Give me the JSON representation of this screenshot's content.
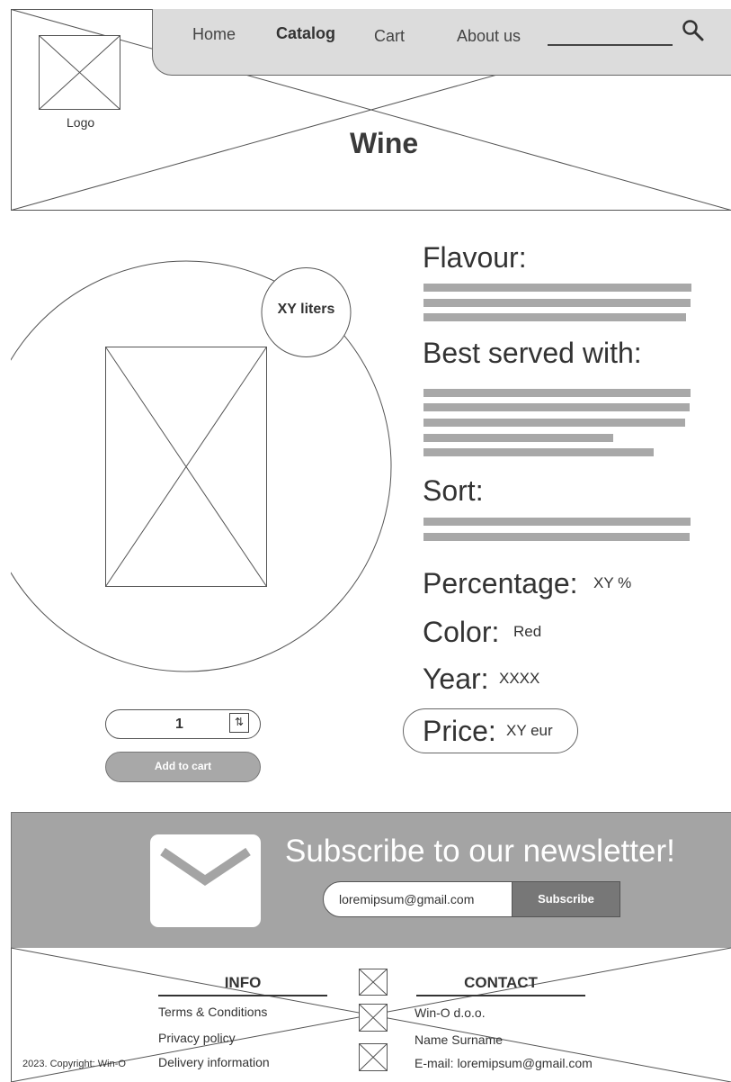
{
  "header": {
    "nav": [
      "Home",
      "Catalog",
      "Cart",
      "About us"
    ],
    "active_nav": "Catalog",
    "logo_label": "Logo",
    "page_title": "Wine",
    "search_icon": "search-icon"
  },
  "product": {
    "volume_badge": "XY liters",
    "flavour_heading": "Flavour:",
    "served_heading": "Best served with:",
    "sort_heading": "Sort:",
    "percentage_label": "Percentage:",
    "percentage_value": "XY %",
    "color_label": "Color:",
    "color_value": "Red",
    "year_label": "Year:",
    "year_value": "XXXX",
    "price_label": "Price:",
    "price_value": "XY eur",
    "quantity": "1",
    "quantity_icon": "swap-vertical-icon",
    "add_to_cart": "Add to cart"
  },
  "newsletter": {
    "title": "Subscribe to our newsletter!",
    "email_value": "loremipsum@gmail.com",
    "subscribe_label": "Subscribe",
    "icon": "envelope-icon"
  },
  "footer": {
    "info_heading": "INFO",
    "info_links": [
      "Terms & Conditions",
      "Privacy policy",
      "Delivery information"
    ],
    "contact_heading": "CONTACT",
    "contact_lines": [
      "Win-O d.o.o.",
      "Name Surname",
      "E-mail: loremipsum@gmail.com"
    ],
    "copyright": "2023. Copyright: Win-O",
    "social_icons": [
      "social-icon-placeholder",
      "social-icon-placeholder",
      "social-icon-placeholder"
    ]
  },
  "colors": {
    "nav_bg": "#dcdcdc",
    "placeholder_bar": "#a8a8a8",
    "newsletter_bg": "#a4a4a4",
    "button_dark": "#777777"
  }
}
